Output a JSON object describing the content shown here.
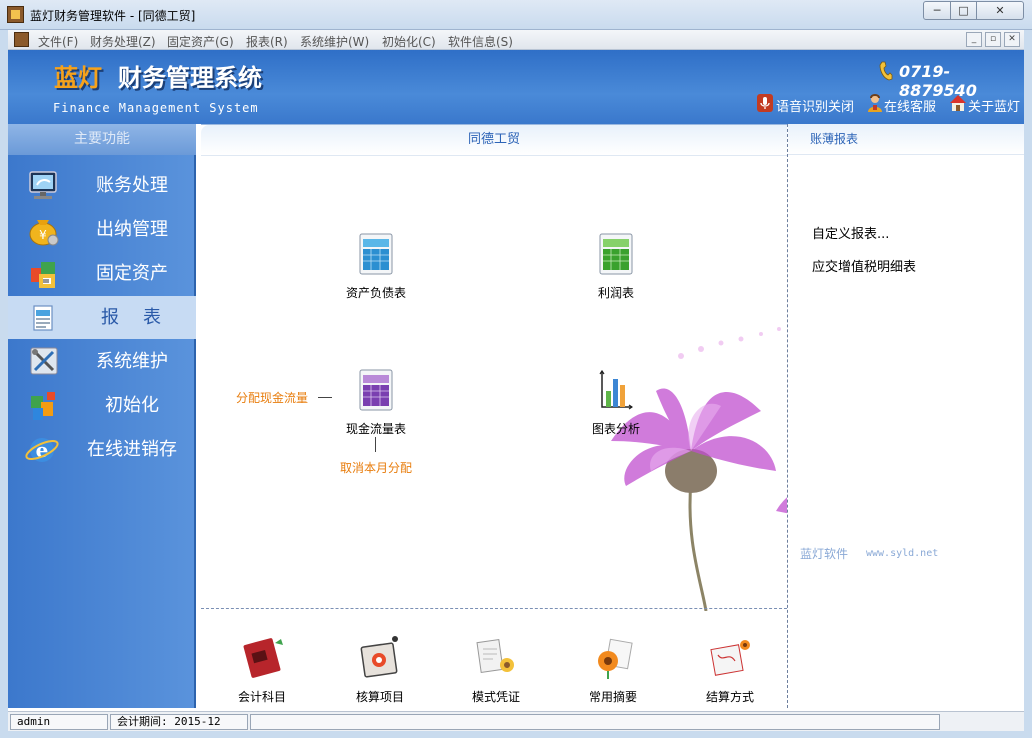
{
  "window": {
    "title": "蓝灯财务管理软件 - [同德工贸]",
    "minimize": "─",
    "maximize": "□",
    "close": "✕"
  },
  "menubar": {
    "items": [
      "文件(F)",
      "财务处理(Z)",
      "固定资产(G)",
      "报表(R)",
      "系统维护(W)",
      "初始化(C)",
      "软件信息(S)"
    ],
    "mdi_min": "_",
    "mdi_restore": "▫",
    "mdi_close": "✕"
  },
  "header": {
    "brand": "蓝灯",
    "title": "财务管理系统",
    "subtitle": "Finance Management System",
    "phone": "0719-8879540",
    "links": [
      "语音识别关闭",
      "在线客服",
      "关于蓝灯"
    ]
  },
  "sidebar": {
    "heading": "主要功能",
    "items": [
      {
        "label": "账务处理",
        "icon": "monitor-icon"
      },
      {
        "label": "出纳管理",
        "icon": "money-bag-icon"
      },
      {
        "label": "固定资产",
        "icon": "asset-boxes-icon"
      },
      {
        "label": "报表",
        "icon": "report-sheet-icon"
      },
      {
        "label": "系统维护",
        "icon": "tools-icon"
      },
      {
        "label": "初始化",
        "icon": "init-cubes-icon"
      },
      {
        "label": "在线进销存",
        "icon": "browser-e-icon"
      }
    ],
    "active_index": 3
  },
  "main": {
    "heading": "同德工贸",
    "reports": [
      {
        "label": "资产负债表",
        "icon": "balance-sheet-icon"
      },
      {
        "label": "利润表",
        "icon": "profit-sheet-icon"
      },
      {
        "label": "现金流量表",
        "icon": "cashflow-sheet-icon"
      },
      {
        "label": "图表分析",
        "icon": "bar-chart-icon"
      }
    ],
    "links": {
      "allocate": "分配现金流量",
      "cancel": "取消本月分配"
    },
    "bottom": [
      {
        "label": "会计科目",
        "icon": "ledger-book-icon"
      },
      {
        "label": "核算项目",
        "icon": "accounting-items-icon"
      },
      {
        "label": "模式凭证",
        "icon": "voucher-template-icon"
      },
      {
        "label": "常用摘要",
        "icon": "summary-flower-icon"
      },
      {
        "label": "结算方式",
        "icon": "settlement-icon"
      }
    ]
  },
  "right": {
    "heading": "账薄报表",
    "links": [
      "自定义报表...",
      "应交增值税明细表"
    ],
    "watermark": "蓝灯软件",
    "watermark_url": "www.syld.net"
  },
  "status": {
    "user": "admin",
    "period": "会计期间: 2015-12"
  }
}
